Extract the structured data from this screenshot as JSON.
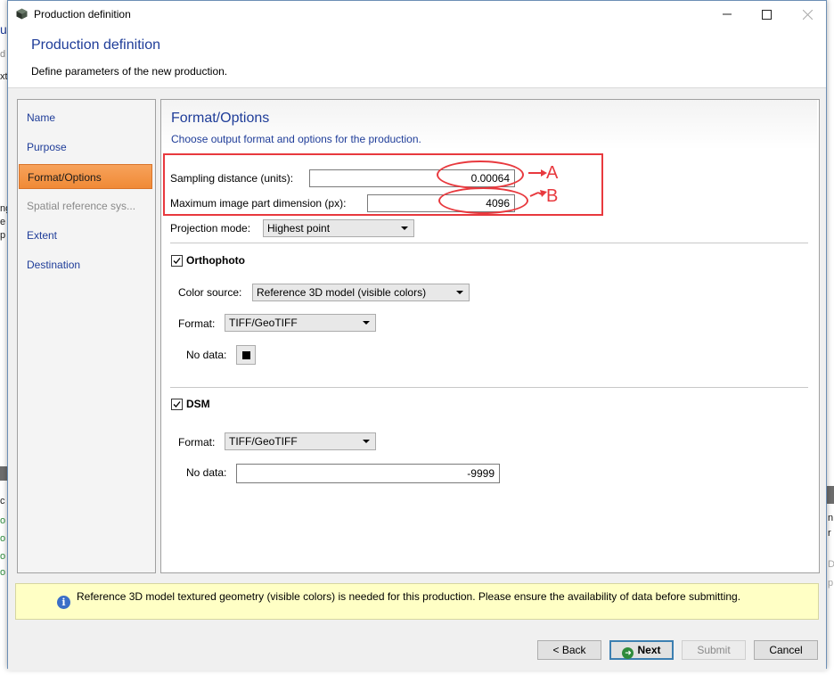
{
  "dialog": {
    "window_title": "Production definition",
    "header_title": "Production definition",
    "header_subtitle": "Define parameters of the new production."
  },
  "nav": {
    "items": [
      {
        "label": "Name",
        "state": "normal"
      },
      {
        "label": "Purpose",
        "state": "normal"
      },
      {
        "label": "Format/Options",
        "state": "active"
      },
      {
        "label": "Spatial reference sys...",
        "state": "disabled"
      },
      {
        "label": "Extent",
        "state": "normal"
      },
      {
        "label": "Destination",
        "state": "normal"
      }
    ]
  },
  "main": {
    "section_title": "Format/Options",
    "section_subtitle": "Choose output format and options for the production.",
    "sampling_distance": {
      "label": "Sampling distance (units):",
      "value": "0.00064"
    },
    "max_image_part": {
      "label": "Maximum image part dimension (px):",
      "value": "4096"
    },
    "projection_mode": {
      "label": "Projection mode:",
      "value": "Highest point"
    },
    "orthophoto": {
      "label": "Orthophoto",
      "checked": true,
      "color_source": {
        "label": "Color source:",
        "value": "Reference 3D model (visible colors)"
      },
      "format": {
        "label": "Format:",
        "value": "TIFF/GeoTIFF"
      },
      "no_data": {
        "label": "No data:",
        "color": "#000000"
      }
    },
    "dsm": {
      "label": "DSM",
      "checked": true,
      "format": {
        "label": "Format:",
        "value": "TIFF/GeoTIFF"
      },
      "no_data": {
        "label": "No data:",
        "value": "-9999"
      }
    }
  },
  "info": {
    "text": "Reference 3D model textured geometry (visible colors) is needed for this production. Please ensure the availability of data before submitting."
  },
  "buttons": {
    "back": "< Back",
    "next": "Next",
    "submit": "Submit",
    "cancel": "Cancel"
  },
  "annotations": {
    "marker_a": "A",
    "marker_b": "B",
    "color": "#e8393e"
  }
}
